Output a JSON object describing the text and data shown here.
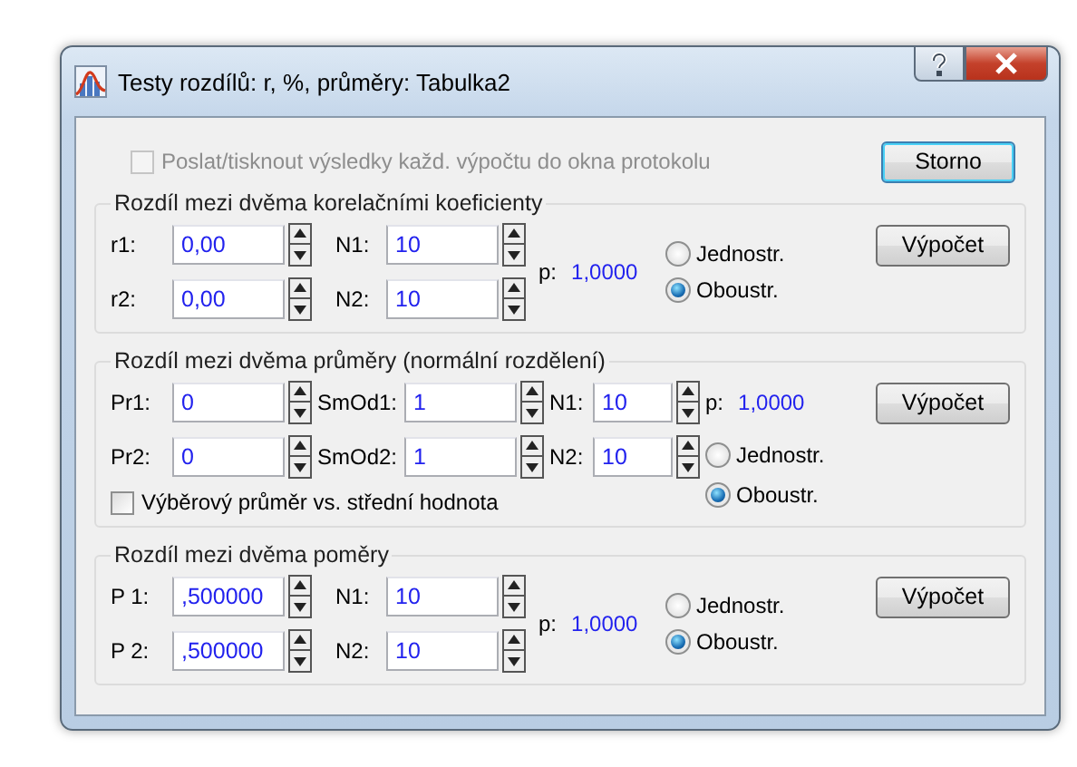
{
  "window": {
    "title": "Testy rozdílů: r, %, průměry: Tabulka2"
  },
  "send_checkbox": {
    "label": "Poslat/tisknout výsledky každ. výpočtu do okna protokolu",
    "checked": false,
    "disabled": true
  },
  "cancel_button": "Storno",
  "groups": [
    {
      "kind": "pair",
      "title": "Rozdíl mezi dvěma korelačními koeficienty",
      "fields": [
        [
          {
            "label": "r1:",
            "value": "0,00"
          },
          {
            "label": "N1:",
            "value": "10"
          }
        ],
        [
          {
            "label": "r2:",
            "value": "0,00"
          },
          {
            "label": "N2:",
            "value": "10"
          }
        ]
      ],
      "p_label": "p:",
      "p_value": "1,0000",
      "radios": [
        {
          "label": "Jednostr.",
          "selected": false
        },
        {
          "label": "Oboustr.",
          "selected": true
        }
      ],
      "button": "Výpočet"
    },
    {
      "kind": "means",
      "title": "Rozdíl mezi dvěma průměry (normální rozdělení)",
      "fields": [
        [
          {
            "label": "Pr1:",
            "value": "0"
          },
          {
            "label": "SmOd1:",
            "value": "1"
          },
          {
            "label": "N1:",
            "value": "10"
          }
        ],
        [
          {
            "label": "Pr2:",
            "value": "0"
          },
          {
            "label": "SmOd2:",
            "value": "1"
          },
          {
            "label": "N2:",
            "value": "10"
          }
        ]
      ],
      "p_label": "p:",
      "p_value": "1,0000",
      "radios": [
        {
          "label": "Jednostr.",
          "selected": false
        },
        {
          "label": "Oboustr.",
          "selected": true
        }
      ],
      "button": "Výpočet",
      "checkbox": {
        "label": "Výběrový průměr vs. střední hodnota",
        "checked": false
      }
    },
    {
      "kind": "pair",
      "title": "Rozdíl mezi dvěma poměry",
      "fields": [
        [
          {
            "label": "P 1:",
            "value": ",500000"
          },
          {
            "label": "N1:",
            "value": "10"
          }
        ],
        [
          {
            "label": "P 2:",
            "value": ",500000"
          },
          {
            "label": "N2:",
            "value": "10"
          }
        ]
      ],
      "p_label": "p:",
      "p_value": "1,0000",
      "radios": [
        {
          "label": "Jednostr.",
          "selected": false
        },
        {
          "label": "Oboustr.",
          "selected": true
        }
      ],
      "button": "Výpočet"
    }
  ]
}
